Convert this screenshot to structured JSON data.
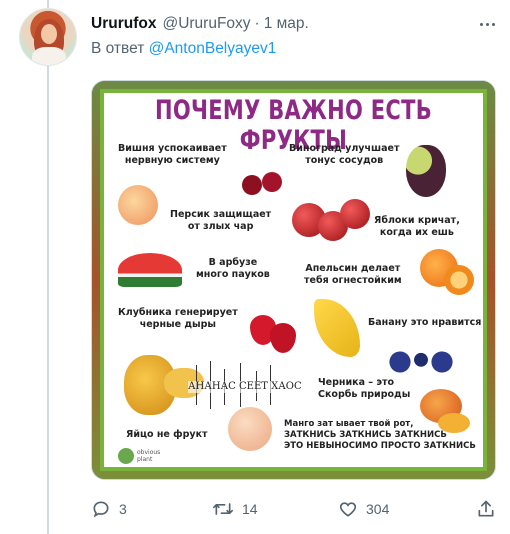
{
  "tweet": {
    "display_name": "Ururufox",
    "handle": "@UruruFoxy",
    "separator": "·",
    "date": "1 мар.",
    "reply_prefix": "В ответ",
    "reply_to": "@AntonBelyayev1"
  },
  "image": {
    "title": "ПОЧЕМУ ВАЖНО ЕСТЬ ФРУКТЫ",
    "labels": {
      "cherry_1": "Вишня успокаивает",
      "cherry_2": "нервную систему",
      "grape_1": "Виноград улучшает",
      "grape_2": "тонус сосудов",
      "peach_1": "Персик защищает",
      "peach_2": "от злых чар",
      "apple_1": "Яблоки кричат,",
      "apple_2": "когда их ешь",
      "melon_1": "В арбузе",
      "melon_2": "много пауков",
      "orange_1": "Апельсин делает",
      "orange_2": "тебя огнестойким",
      "straw_1": "Клубника генерирует",
      "straw_2": "черные дыры",
      "banana": "Банану это нравится",
      "pineapple": "АНАНАС СЕЕТ ХАОС",
      "blueberry_1": "Черника – это",
      "blueberry_2": "Скорбь природы",
      "egg": "Яйцо не фрукт",
      "mango_1": "Манго зат ывает твой рот,",
      "mango_2": "ЗАТКНИСЬ ЗАТКНИСЬ ЗАТКНИСЬ",
      "mango_3": "ЭТО НЕВЫНОСИМО ПРОСТО ЗАТКНИСЬ",
      "logo_1": "obvious",
      "logo_2": "plant"
    }
  },
  "actions": {
    "replies": "3",
    "retweets": "14",
    "likes": "304"
  },
  "colors": {
    "link": "#1d9bf0",
    "muted": "#536471",
    "poster_title": "#8e2a85",
    "poster_border": "#79b43a"
  },
  "icons": [
    "more-icon",
    "reply-icon",
    "retweet-icon",
    "like-icon",
    "share-icon"
  ]
}
